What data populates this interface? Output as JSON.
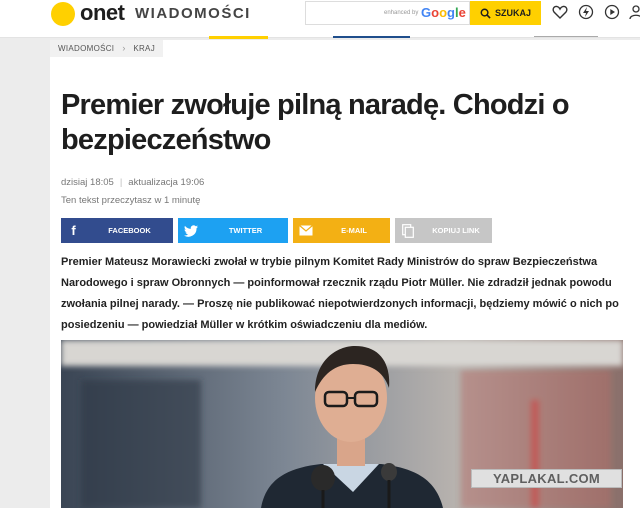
{
  "header": {
    "logo": "onet",
    "section": "WIADOMOŚCI",
    "search_enhanced": "enhanced by",
    "search_google": "Google",
    "search_button": "SZUKAJ"
  },
  "breadcrumbs": [
    "WIADOMOŚCI",
    "KRAJ"
  ],
  "article": {
    "title": "Premier zwołuje pilną naradę. Chodzi o bezpieczeństwo",
    "published": "dzisiaj 18:05",
    "updated": "aktualizacja 19:06",
    "read_time": "Ten tekst przeczytasz w 1 minutę",
    "lead": "Premier Mateusz Morawiecki zwołał w trybie pilnym Komitet Rady Ministrów do spraw Bezpieczeństwa Narodowego i spraw Obronnych — poinformował rzecznik rządu Piotr Müller. Nie zdradził jednak powodu zwołania pilnej narady. — Proszę nie publikować niepotwierdzonych informacji, będziemy mówić o nich po posiedzeniu — powiedział Müller w krótkim oświadczeniu dla mediów."
  },
  "share": {
    "facebook": "FACEBOOK",
    "twitter": "TWITTER",
    "email": "E-MAIL",
    "copy": "KOPIUJ LINK"
  },
  "watermark": "YAPLAKAL.COM",
  "colors": {
    "brand_yellow": "#ffd000",
    "facebook": "#324c8e",
    "twitter": "#1da1f2",
    "email": "#f3b014",
    "copy": "#c6c6c6"
  },
  "icons": [
    "search-icon",
    "heart-icon",
    "bolt-icon",
    "play-icon",
    "user-icon",
    "facebook-icon",
    "twitter-icon",
    "mail-icon",
    "copy-icon"
  ]
}
